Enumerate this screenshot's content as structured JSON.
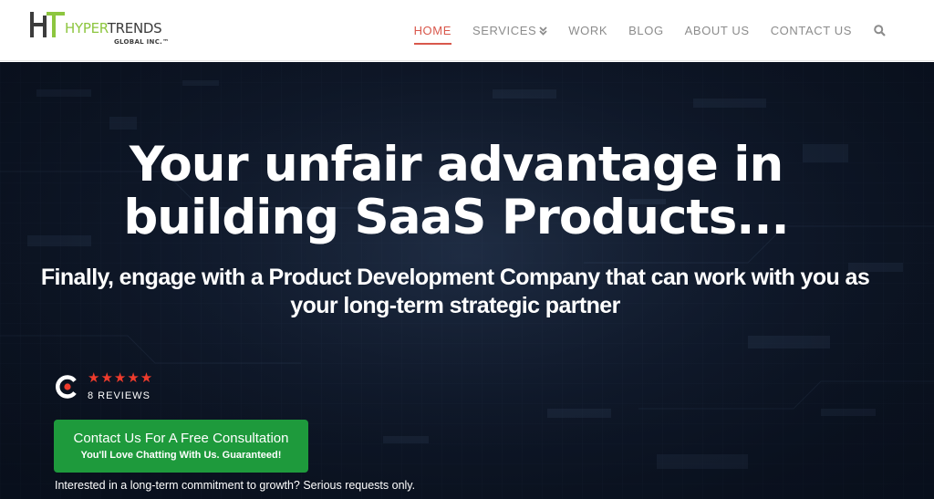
{
  "brand": {
    "name_part1": "HYPER",
    "name_part2": "TRENDS",
    "tagline": "GLOBAL INC.™",
    "accent_color": "#8dc63f",
    "dark_color": "#3c3c3c"
  },
  "nav": {
    "items": [
      {
        "label": "HOME",
        "active": true
      },
      {
        "label": "SERVICES",
        "active": false,
        "icon": "chevron-double-down-icon"
      },
      {
        "label": "WORK",
        "active": false
      },
      {
        "label": "BLOG",
        "active": false
      },
      {
        "label": "ABOUT US",
        "active": false
      },
      {
        "label": "CONTACT US",
        "active": false
      }
    ],
    "search_icon": "search-icon",
    "active_color": "#d9584c",
    "inactive_color": "#8c8c8c"
  },
  "hero": {
    "headline_line1": "Your unfair advantage in",
    "headline_line2": "building SaaS Products...",
    "subhead_line1": "Finally, engage with a Product Development Company that can work with you as",
    "subhead_line2": "your long-term strategic partner",
    "reviews": {
      "stars": "★★★★★",
      "rating": 5,
      "count_label": "8 REVIEWS",
      "logo_icon": "clutch-logo-icon",
      "star_color": "#ef3b2c"
    },
    "cta": {
      "main_label": "Contact Us For A Free Consultation",
      "sub_label": "You'll Love Chatting With Us. Guaranteed!",
      "color": "#1e9a3c"
    },
    "note": "Interested in a long-term commitment to growth? Serious requests only."
  }
}
